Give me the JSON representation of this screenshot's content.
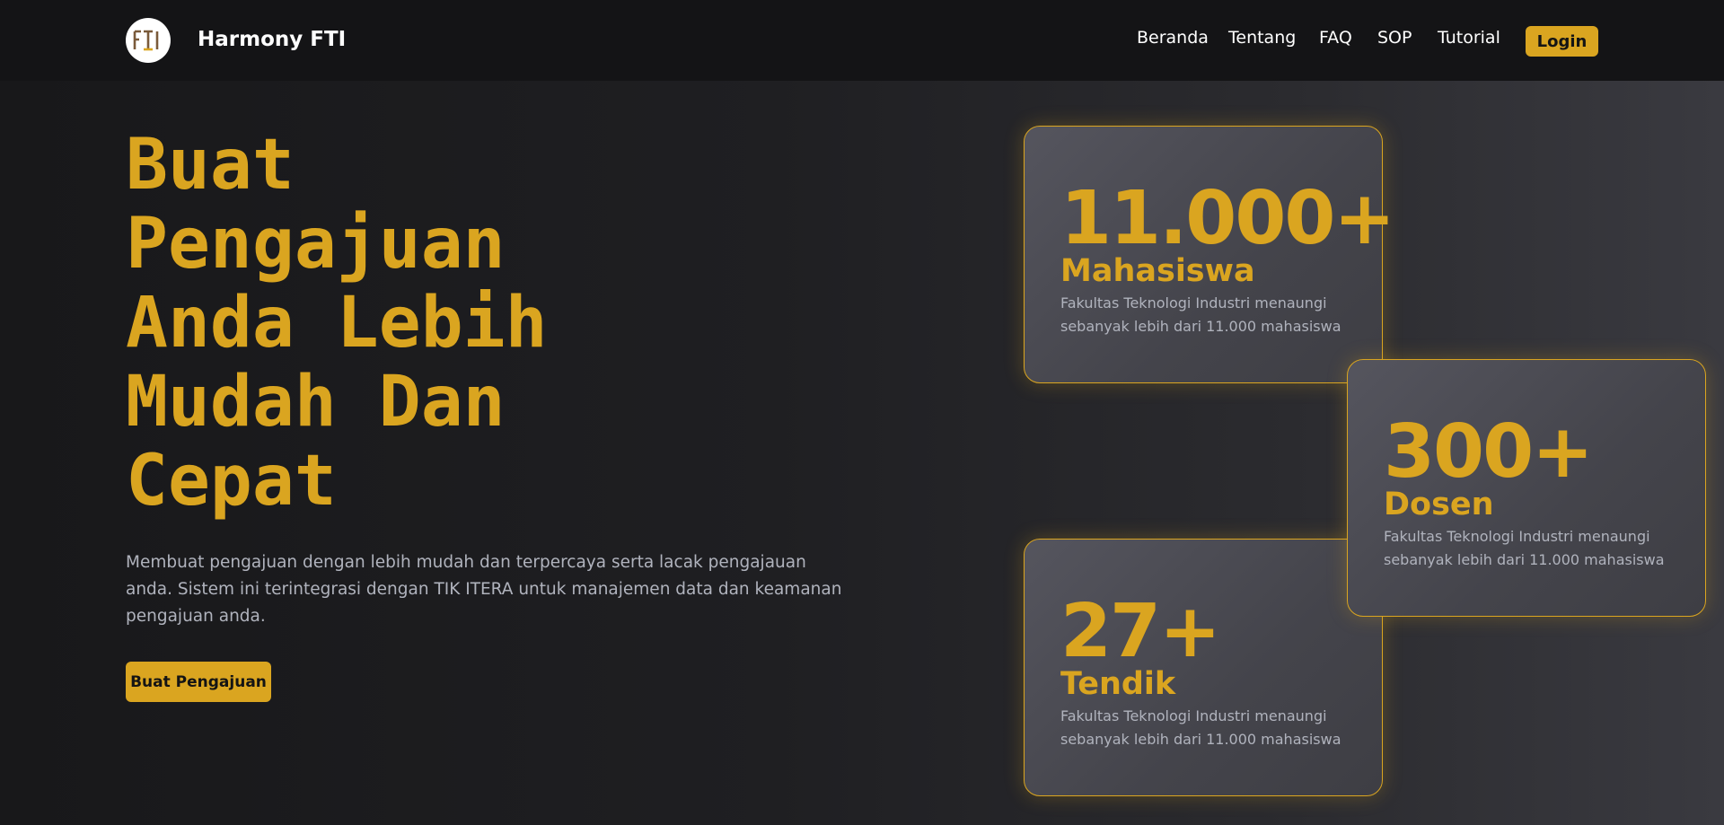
{
  "nav": {
    "brand": "Harmony FTI",
    "logo_text": "FTI",
    "links": [
      "Beranda",
      "Tentang",
      "FAQ",
      "SOP",
      "Tutorial"
    ],
    "login_label": "Login"
  },
  "hero": {
    "title_lines": [
      "Buat",
      "Pengajuan",
      "Anda Lebih",
      "Mudah Dan",
      "Cepat"
    ],
    "description": "Membuat pengajuan dengan lebih mudah dan terpercaya serta lacak pengajauan anda. Sistem ini terintegrasi dengan TIK ITERA untuk manajemen data dan keamanan pengajuan anda.",
    "cta_label": "Buat Pengajuan"
  },
  "stats": [
    {
      "number": "11.000+",
      "label": "Mahasiswa",
      "description": "Fakultas Teknologi Industri menaungi sebanyak lebih dari 11.000 mahasiswa"
    },
    {
      "number": "300+",
      "label": "Dosen",
      "description": "Fakultas Teknologi Industri menaungi sebanyak lebih dari 11.000 mahasiswa"
    },
    {
      "number": "27+",
      "label": "Tendik",
      "description": "Fakultas Teknologi Industri menaungi sebanyak lebih dari 11.000 mahasiswa"
    }
  ],
  "colors": {
    "accent": "#daa520",
    "navbar_bg": "#141416",
    "card_bg": "#4c4c54",
    "muted_text": "#b0b3bd"
  }
}
